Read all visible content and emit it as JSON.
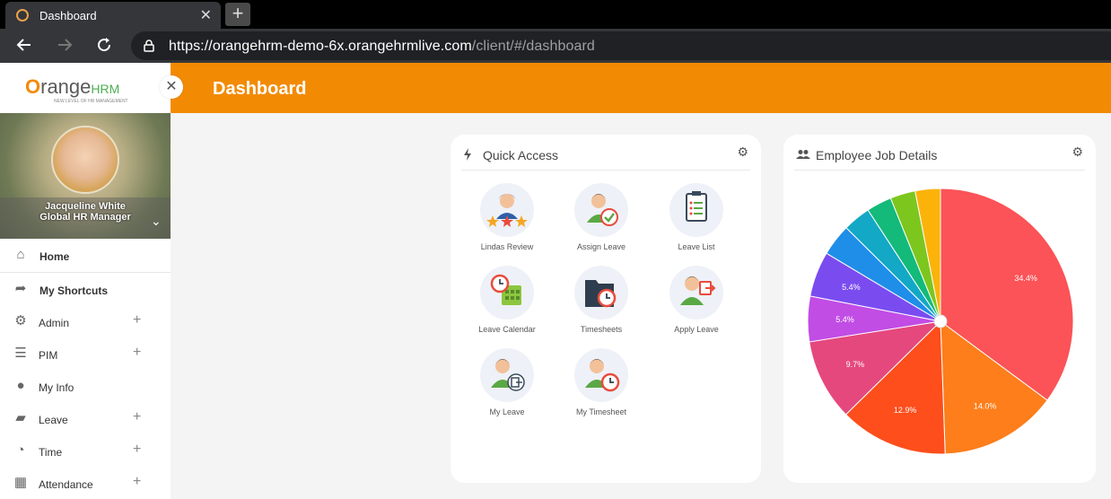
{
  "browser": {
    "tab_title": "Dashboard",
    "tab_close": "✕",
    "new_tab": "+",
    "url_main": "https://orangehrm-demo-6x.orangehrmlive.com",
    "url_rest": "/client/#/dashboard"
  },
  "brand": {
    "logo_text_o": "O",
    "logo_text_range": "range",
    "logo_text_hrm": "HRM",
    "logo_tagline": "NEW LEVEL OF HR MANAGEMENT",
    "collapse": "✕"
  },
  "user": {
    "name": "Jacqueline White",
    "role": "Global HR Manager"
  },
  "menu": [
    {
      "label": "Home",
      "icon": "home-icon",
      "glyph": "⌂",
      "expand": ""
    },
    {
      "label": "My Shortcuts",
      "icon": "share-arrow-icon",
      "glyph": "➦",
      "expand": ""
    },
    {
      "label": "Admin",
      "icon": "admin-icon",
      "glyph": "⚙",
      "expand": "+"
    },
    {
      "label": "PIM",
      "icon": "pim-icon",
      "glyph": "☰",
      "expand": "+"
    },
    {
      "label": "My Info",
      "icon": "user-circle-icon",
      "glyph": "●",
      "expand": ""
    },
    {
      "label": "Leave",
      "icon": "briefcase-icon",
      "glyph": "▰",
      "expand": "+"
    },
    {
      "label": "Time",
      "icon": "clock-icon",
      "glyph": "◔",
      "expand": "+"
    },
    {
      "label": "Attendance",
      "icon": "calendar-icon",
      "glyph": "▦",
      "expand": "+"
    }
  ],
  "header": {
    "title": "Dashboard"
  },
  "quick_access": {
    "title": "Quick Access",
    "items": [
      {
        "label": "Lindas Review",
        "icon": "review-icon"
      },
      {
        "label": "Assign Leave",
        "icon": "assign-leave-icon"
      },
      {
        "label": "Leave List",
        "icon": "leave-list-icon"
      },
      {
        "label": "Leave Calendar",
        "icon": "leave-calendar-icon"
      },
      {
        "label": "Timesheets",
        "icon": "timesheets-icon"
      },
      {
        "label": "Apply Leave",
        "icon": "apply-leave-icon"
      },
      {
        "label": "My Leave",
        "icon": "my-leave-icon"
      },
      {
        "label": "My Timesheet",
        "icon": "my-timesheet-icon"
      }
    ]
  },
  "job_details": {
    "title": "Employee Job Details"
  },
  "chart_data": {
    "type": "pie",
    "slices": [
      {
        "value": 34.4,
        "label": "34.4%",
        "color": "#fb5357"
      },
      {
        "value": 14.0,
        "label": "14.0%",
        "color": "#fd7e1a"
      },
      {
        "value": 12.9,
        "label": "12.9%",
        "color": "#fd4e1c"
      },
      {
        "value": 9.7,
        "label": "9.7%",
        "color": "#e5487d"
      },
      {
        "value": 5.4,
        "label": "5.4%",
        "color": "#c14de5"
      },
      {
        "value": 5.4,
        "label": "5.4%",
        "color": "#7a4cf0"
      },
      {
        "value": 3.8,
        "label": "",
        "color": "#1f8ee8"
      },
      {
        "value": 3.3,
        "label": "",
        "color": "#12a8c6"
      },
      {
        "value": 3.0,
        "label": "",
        "color": "#13ba7a"
      },
      {
        "value": 3.0,
        "label": "",
        "color": "#7dc61e"
      },
      {
        "value": 3.0,
        "label": "",
        "color": "#fbb30a"
      }
    ]
  }
}
